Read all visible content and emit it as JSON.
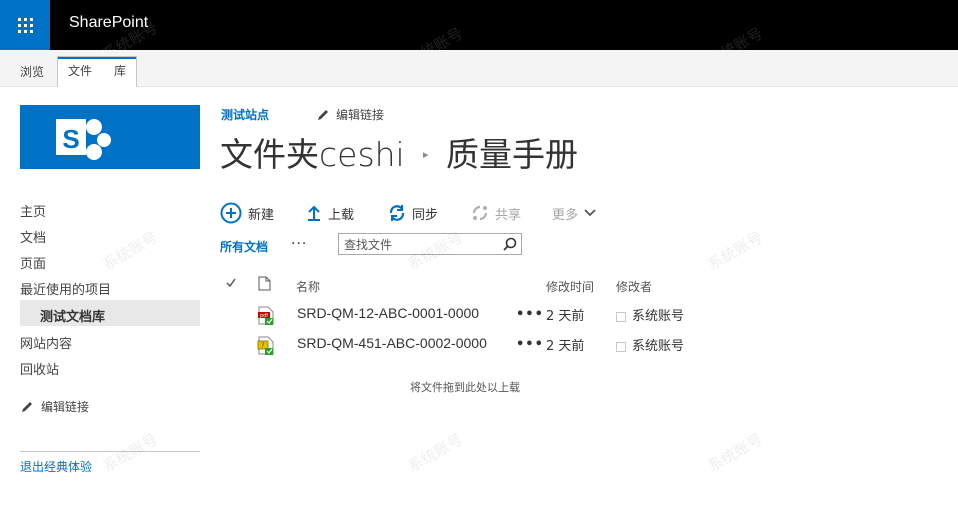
{
  "app": {
    "brand": "SharePoint",
    "accent": "#0072c6"
  },
  "ribbon": {
    "tabs": [
      "浏览",
      "文件",
      "库"
    ]
  },
  "quick_launch": {
    "items": [
      "主页",
      "文档",
      "页面",
      "最近使用的项目",
      "测试文档库",
      "网站内容",
      "回收站"
    ],
    "edit_links": "编辑链接",
    "exit_classic": "退出经典体验"
  },
  "header": {
    "site_name": "测试站点",
    "edit_links": "编辑链接",
    "folder_title": "文件夹ceshi",
    "page_title": "质量手册"
  },
  "commands": {
    "new": "新建",
    "upload": "上载",
    "sync": "同步",
    "share": "共享",
    "more": "更多"
  },
  "views": {
    "all_docs": "所有文档",
    "more": "···"
  },
  "search": {
    "placeholder": "查找文件"
  },
  "table": {
    "headers": {
      "name": "名称",
      "modified": "修改时间",
      "modified_by": "修改者"
    },
    "rows": [
      {
        "name": "SRD-QM-12-ABC-0001-0000",
        "icon": "pdf-file-icon",
        "modified": "2 天前",
        "modified_by": "系统账号"
      },
      {
        "name": "SRD-QM-451-ABC-0002-0000",
        "icon": "generic-file-icon",
        "modified": "2 天前",
        "modified_by": "系统账号"
      }
    ],
    "row_menu": "•••"
  },
  "drop_hint": "将文件拖到此处以上载",
  "watermark": "系统账号"
}
